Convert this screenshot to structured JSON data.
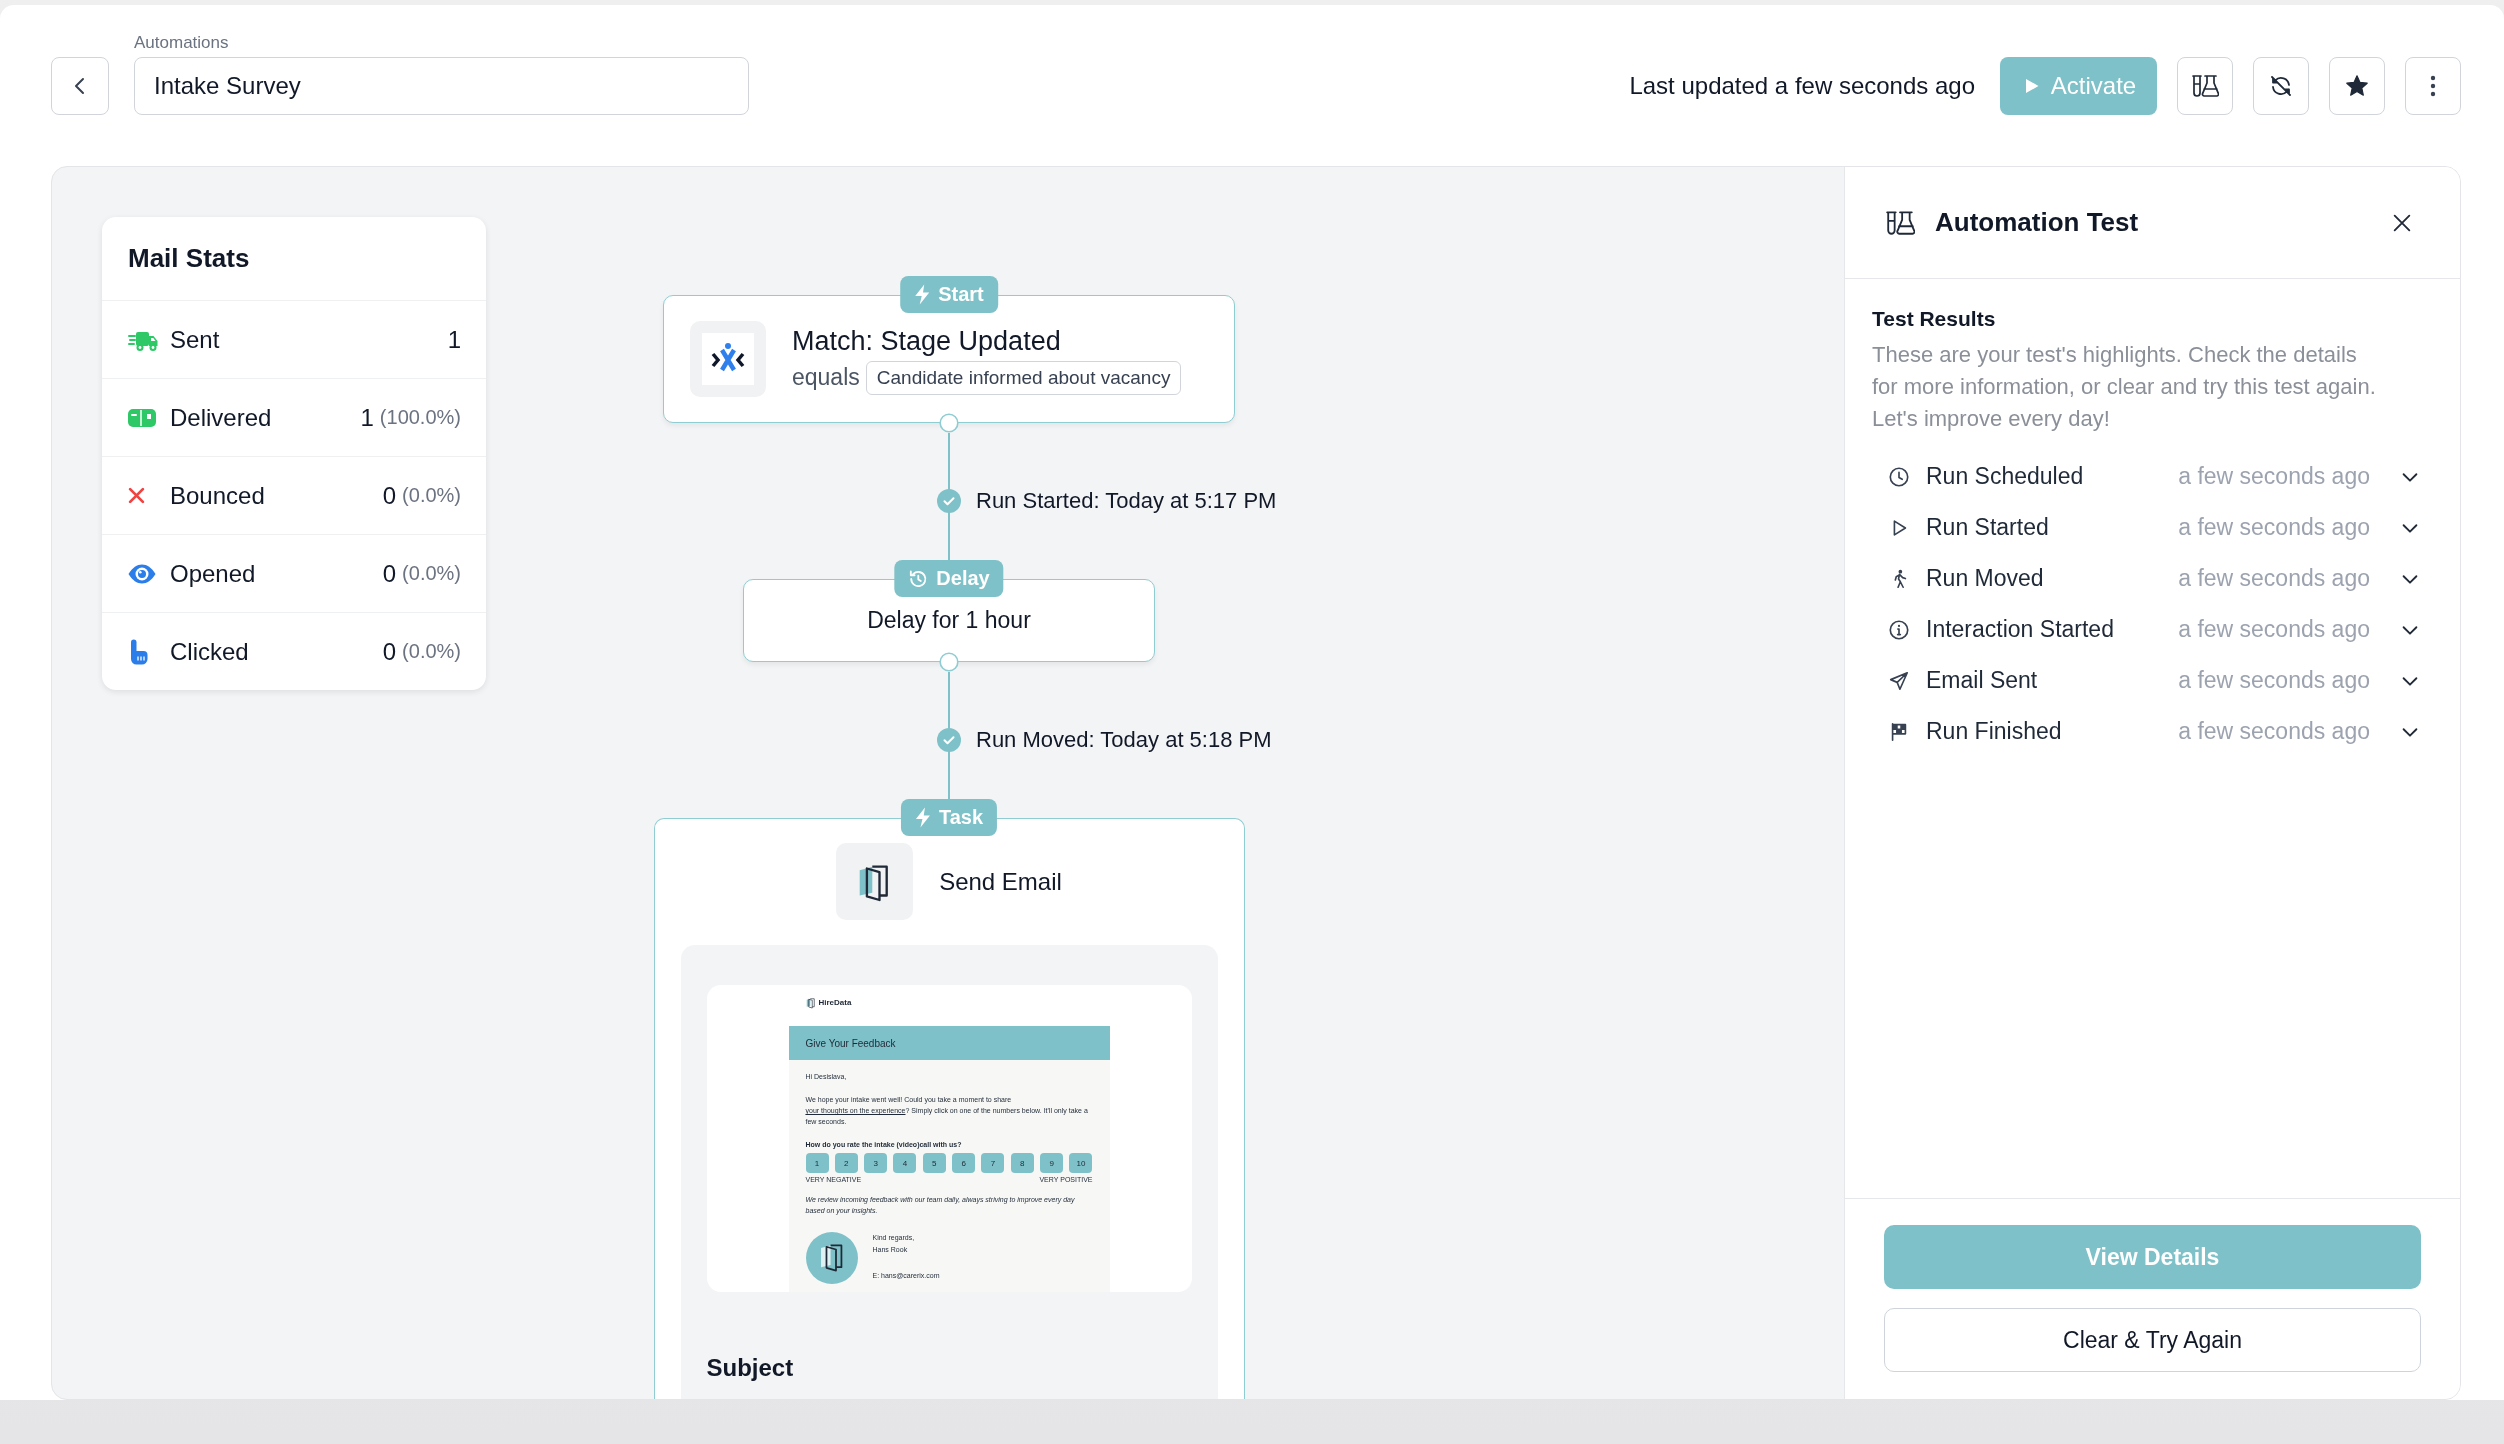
{
  "header": {
    "breadcrumb": "Automations",
    "title": "Intake Survey",
    "last_updated": "Last updated a few seconds ago",
    "activate_label": "Activate"
  },
  "mail_stats": {
    "title": "Mail Stats",
    "stats": [
      {
        "label": "Sent",
        "count": "1",
        "color": "#2ec866"
      },
      {
        "label": "Delivered",
        "count": "1",
        "percent": "(100.0%)",
        "color": "#2ec866"
      },
      {
        "label": "Bounced",
        "count": "0",
        "percent": "(0.0%)",
        "color": "#ef4444"
      },
      {
        "label": "Opened",
        "count": "0",
        "percent": "(0.0%)",
        "color": "#2b7de9"
      },
      {
        "label": "Clicked",
        "count": "0",
        "percent": "(0.0%)",
        "color": "#2b7de9"
      }
    ]
  },
  "flow": {
    "steps": [
      {
        "kind": "trigger",
        "badge": "Start",
        "title": "Match: Stage Updated",
        "operator": "equals",
        "value": "Candidate informed about vacancy"
      },
      {
        "kind": "checkpoint",
        "passed": true,
        "text": "Run Started: Today at 5:17 PM"
      },
      {
        "kind": "delay",
        "badge": "Delay",
        "title": "Delay for 1 hour"
      },
      {
        "kind": "checkpoint",
        "passed": true,
        "text": "Run Moved: Today at 5:18 PM"
      },
      {
        "kind": "task",
        "badge": "Task",
        "title": "Send Email",
        "email": {
          "brand": "HireData",
          "heading": "Give Your Feedback",
          "greeting": "Hi Desislava,",
          "intro_start": "We hope your intake went well! Could you take a moment to share ",
          "intro_link": "your thoughts on the experience",
          "intro_end": "? Simply click on one of the numbers below. It'll only take a few seconds.",
          "question": "How do you rate the intake (video)call with us?",
          "scale": [
            "1",
            "2",
            "3",
            "4",
            "5",
            "6",
            "7",
            "8",
            "9",
            "10"
          ],
          "scale_low": "VERY NEGATIVE",
          "scale_high": "VERY POSITIVE",
          "note": "We review incoming feedback with our team daily, always striving to improve every day based on your insights.",
          "signoff": "Kind regards,",
          "sender": "Hans Rook",
          "contact": "E: hans@carerix.com"
        },
        "subject_label": "Subject"
      }
    ]
  },
  "test_panel": {
    "title": "Automation Test",
    "results_title": "Test Results",
    "description": "These are your test's highlights. Check the details for more information, or clear and try this test again. Let's improve every day!",
    "events": [
      {
        "label": "Run Scheduled",
        "time": "a few seconds ago",
        "expanded": false
      },
      {
        "label": "Run Started",
        "time": "a few seconds ago",
        "expanded": false
      },
      {
        "label": "Run Moved",
        "time": "a few seconds ago",
        "expanded": false
      },
      {
        "label": "Interaction Started",
        "time": "a few seconds ago",
        "expanded": false
      },
      {
        "label": "Email Sent",
        "time": "a few seconds ago",
        "expanded": false
      },
      {
        "label": "Run Finished",
        "time": "a few seconds ago",
        "expanded": false
      }
    ],
    "buttons": [
      {
        "label": "View Details",
        "kind": "primary"
      },
      {
        "label": "Clear & Try Again",
        "kind": "secondary"
      }
    ]
  }
}
